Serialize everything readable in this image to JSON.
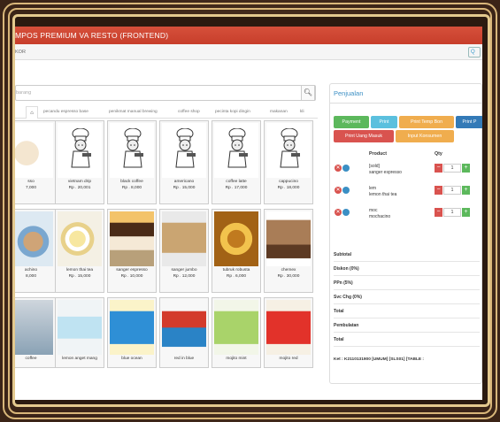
{
  "app": {
    "title": "MPOS PREMIUM VA RESTO (FRONTEND)",
    "subbar_left": "KOR",
    "subbar_right": "Q"
  },
  "search": {
    "placeholder": "barang"
  },
  "tabs": [
    "pecandu espresso base",
    "penikmat manual brewing",
    "coffee shop",
    "pecinta kopi dingin",
    "makanan",
    "kli"
  ],
  "products": [
    {
      "name": "sso",
      "price": "7,000"
    },
    {
      "name": "vietnam drip",
      "price": "Rp . 20,001"
    },
    {
      "name": "black coffee",
      "price": "Rp . 8,000"
    },
    {
      "name": "americano",
      "price": "Rp . 15,000"
    },
    {
      "name": "coffee latte",
      "price": "Rp . 17,000"
    },
    {
      "name": "cappucino",
      "price": "Rp . 18,000"
    },
    {
      "name": "achino",
      "price": "8,000"
    },
    {
      "name": "lemon thai tea",
      "price": "Rp . 15,000"
    },
    {
      "name": "sanger espresso",
      "price": "Rp . 10,000"
    },
    {
      "name": "sanger jumbo",
      "price": "Rp . 12,000"
    },
    {
      "name": "tubruk robusta",
      "price": "Rp . 6,000"
    },
    {
      "name": "chemex",
      "price": "Rp . 30,000"
    },
    {
      "name": "coffee",
      "price": ""
    },
    {
      "name": "lemon anget mang",
      "price": ""
    },
    {
      "name": "blue ocean",
      "price": ""
    },
    {
      "name": "red in blue",
      "price": ""
    },
    {
      "name": "mojito mint",
      "price": ""
    },
    {
      "name": "mojito red",
      "price": ""
    }
  ],
  "sales": {
    "title": "Penjualan",
    "buttons": [
      "Payment",
      "Print",
      "Print Temp Bon",
      "Print P",
      "Print Uang Masuk",
      "Input Konsumen"
    ],
    "col_product": "Product",
    "col_qty": "Qty",
    "items": [
      {
        "line1": "[sold]",
        "line2": "sanger espresso",
        "qty": "1"
      },
      {
        "line1": "lem",
        "line2": "lemon thai tea",
        "qty": "1"
      },
      {
        "line1": "moc",
        "line2": "mochacino",
        "qty": "1"
      }
    ],
    "summary": [
      "Subtotal",
      "Diskon (0%)",
      "PPn (5%)",
      "Svc Chg (0%)",
      "Total",
      "Pembulatan",
      "Total"
    ],
    "ket": "Ket : K2110131900 [UMUM] [SLS01] [TABLE :"
  },
  "colors": {
    "topbar": "#c73e2b",
    "accent_blue": "#3b8fc4",
    "payment_green": "#5cb85c",
    "print_blue": "#5bc0de",
    "orange": "#f0ad4e",
    "red": "#d9534f"
  }
}
